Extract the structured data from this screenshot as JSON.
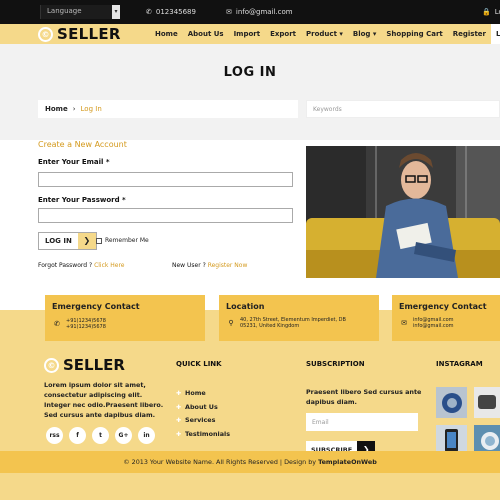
{
  "topbar": {
    "language": "Language",
    "phone": "012345689",
    "email": "info@gmail.com",
    "login": "Lo"
  },
  "brand": {
    "name": "SELLER"
  },
  "menu": [
    {
      "label": "Home"
    },
    {
      "label": "About Us"
    },
    {
      "label": "Import"
    },
    {
      "label": "Export"
    },
    {
      "label": "Product ▾"
    },
    {
      "label": "Blog ▾"
    },
    {
      "label": "Shopping Cart"
    },
    {
      "label": "Register"
    },
    {
      "label": "Log"
    }
  ],
  "page": {
    "title": "LOG IN"
  },
  "breadcrumb": {
    "home": "Home",
    "current": "Log In"
  },
  "search": {
    "placeholder": "Keywords"
  },
  "form": {
    "heading": "Create a New Account",
    "email_label": "Enter Your Email",
    "password_label": "Enter Your Password",
    "required": "*",
    "login_button": "LOG IN",
    "remember": "Remember Me",
    "forgot_text": "Forgot Password ?",
    "forgot_link": "Click Here",
    "newuser_text": "New User ?",
    "register_link": "Register Now"
  },
  "info": {
    "emergency": {
      "title": "Emergency Contact",
      "line1": "+91(1234)5678",
      "line2": "+91(1234)5678"
    },
    "location": {
      "title": "Location",
      "line1": "40, 27th Street, Elementum Imperdiet, DB",
      "line2": "05231, United Kingdom"
    },
    "emergency2": {
      "title": "Emergency Contact",
      "line1": "info@gmail.com",
      "line2": "info@gmail.com"
    }
  },
  "footer": {
    "description": "Lorem ipsum dolor sit amet, consectetur adipiscing elit. Integer nec odio.Praesent libero. Sed cursus ante dapibus diam.",
    "quick_heading": "QUICK LINK",
    "quick_links": [
      "Home",
      "About Us",
      "Services",
      "Testimonials"
    ],
    "subscription_heading": "SUBSCRIPTION",
    "subscription_text": "Praesent libero Sed cursus ante dapibus diam.",
    "email_placeholder": "Email",
    "subscribe_button": "SUBSCRIBE",
    "instagram_heading": "INSTAGRAM",
    "social": [
      "rss",
      "f",
      "t",
      "G+",
      "in"
    ],
    "copyright": "© 2013 Your Website Name. All Rights Reserved | Design by ",
    "designer": "TemplateOnWeb"
  },
  "colors": {
    "accent": "#f5d98a",
    "accent_dark": "#f3c44f",
    "link": "#d49a1e",
    "dark": "#111111"
  }
}
